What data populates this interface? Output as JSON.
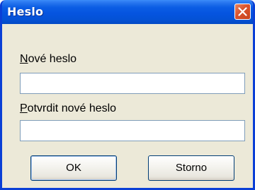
{
  "window": {
    "title": "Heslo",
    "close_icon": "close-icon"
  },
  "form": {
    "new_password_label_mnemonic": "N",
    "new_password_label_rest": "ové heslo",
    "new_password_value": "",
    "confirm_password_label_mnemonic": "P",
    "confirm_password_label_rest": "otvrdit nové heslo",
    "confirm_password_value": ""
  },
  "buttons": {
    "ok_label": "OK",
    "cancel_label": "Storno"
  },
  "colors": {
    "titlebar": "#0554e0",
    "close_button": "#d9522c",
    "dialog_bg": "#ece9d8",
    "field_border": "#7f9db9"
  }
}
